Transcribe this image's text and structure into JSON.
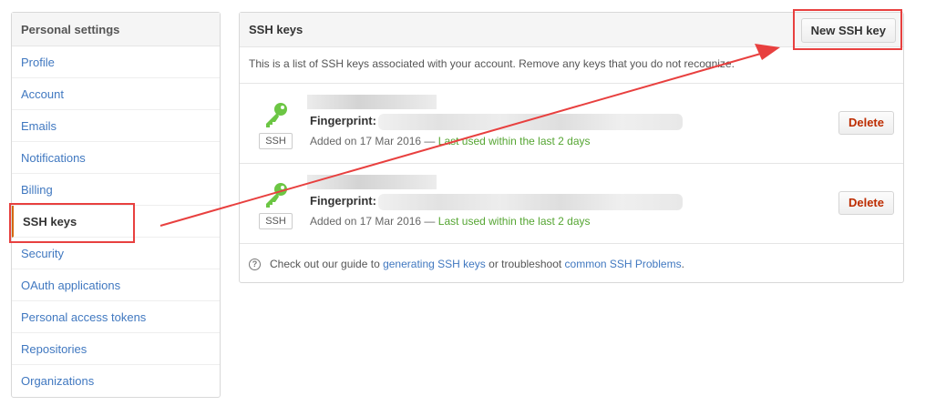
{
  "sidebar": {
    "header": "Personal settings",
    "items": [
      {
        "label": "Profile"
      },
      {
        "label": "Account"
      },
      {
        "label": "Emails"
      },
      {
        "label": "Notifications"
      },
      {
        "label": "Billing"
      },
      {
        "label": "SSH keys",
        "selected": true
      },
      {
        "label": "Security"
      },
      {
        "label": "OAuth applications"
      },
      {
        "label": "Personal access tokens"
      },
      {
        "label": "Repositories"
      },
      {
        "label": "Organizations"
      }
    ]
  },
  "main": {
    "title": "SSH keys",
    "new_key_label": "New SSH key",
    "description": "This is a list of SSH keys associated with your account. Remove any keys that you do not recognize.",
    "keys": [
      {
        "badge": "SSH",
        "fingerprint_label": "Fingerprint:",
        "added_text": "Added on 17 Mar 2016 — ",
        "last_used": "Last used within the last 2 days",
        "delete_label": "Delete"
      },
      {
        "badge": "SSH",
        "fingerprint_label": "Fingerprint:",
        "added_text": "Added on 17 Mar 2016 — ",
        "last_used": "Last used within the last 2 days",
        "delete_label": "Delete"
      }
    ],
    "footer": {
      "prefix": "Check out our guide to ",
      "link1": "generating SSH keys",
      "middle": " or troubleshoot ",
      "link2": "common SSH Problems",
      "suffix": "."
    }
  },
  "colors": {
    "link": "#4078c0",
    "key_green": "#6cc644",
    "last_used_green": "#55a532",
    "delete_red": "#bd2c00",
    "annotation_red": "#e8403f",
    "selected_border": "#d26911"
  },
  "icons": [
    "key-icon",
    "help-icon"
  ]
}
